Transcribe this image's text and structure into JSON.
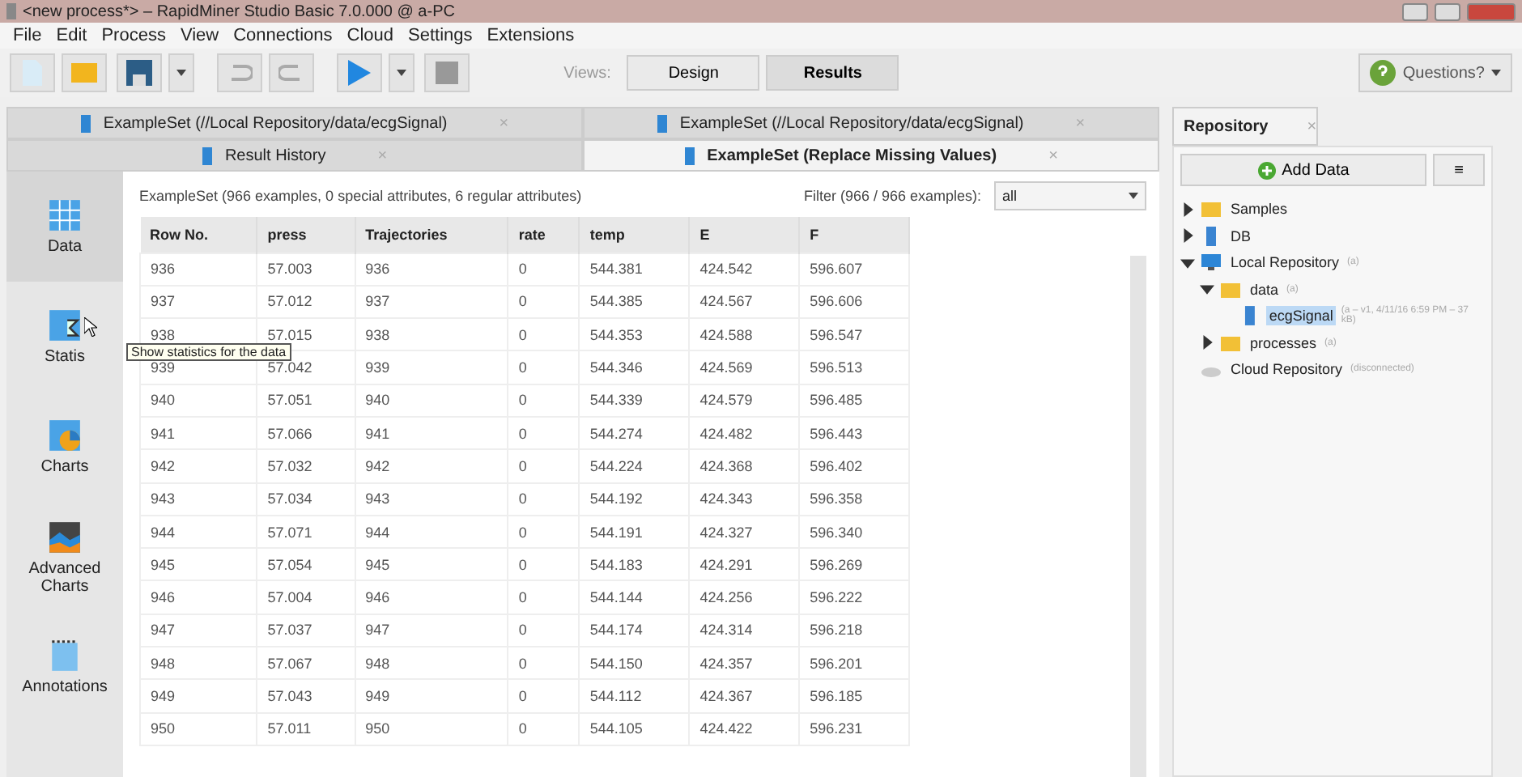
{
  "window": {
    "title": "<new process*> – RapidMiner Studio Basic 7.0.000 @ a-PC"
  },
  "menu": [
    "File",
    "Edit",
    "Process",
    "View",
    "Connections",
    "Cloud",
    "Settings",
    "Extensions"
  ],
  "views": {
    "label": "Views:",
    "items": [
      {
        "label": "Design",
        "selected": false
      },
      {
        "label": "Results",
        "selected": true
      }
    ]
  },
  "help": {
    "label": "Questions?"
  },
  "result_tab_rows": [
    [
      {
        "label": "ExampleSet (//Local Repository/data/ecgSignal)",
        "close": "×",
        "selected": false
      },
      {
        "label": "ExampleSet (//Local Repository/data/ecgSignal)",
        "close": "×",
        "selected": false
      }
    ],
    [
      {
        "label": "Result History",
        "close": "×",
        "selected": false
      },
      {
        "label": "ExampleSet (Replace Missing Values)",
        "close": "×",
        "selected": true
      }
    ]
  ],
  "side_nav": [
    {
      "label": "Data",
      "kind": "table",
      "selected": true
    },
    {
      "label": "Statis",
      "kind": "stats",
      "selected": false
    },
    {
      "label": "Charts",
      "kind": "charts",
      "selected": false
    },
    {
      "label": "Advanced Charts",
      "kind": "advanced",
      "selected": false
    },
    {
      "label": "Annotations",
      "kind": "notes",
      "selected": false
    }
  ],
  "tooltip": "Show statistics for the data",
  "summary": "ExampleSet (966 examples, 0 special attributes, 6 regular attributes)",
  "filter": {
    "label": "Filter (966 / 966 examples):",
    "value": "all"
  },
  "table": {
    "columns": [
      "Row No.",
      "press",
      "Trajectories",
      "rate",
      "temp",
      "E",
      "F"
    ],
    "rows": [
      [
        "936",
        "57.003",
        "936",
        "0",
        "544.381",
        "424.542",
        "596.607"
      ],
      [
        "937",
        "57.012",
        "937",
        "0",
        "544.385",
        "424.567",
        "596.606"
      ],
      [
        "938",
        "57.015",
        "938",
        "0",
        "544.353",
        "424.588",
        "596.547"
      ],
      [
        "939",
        "57.042",
        "939",
        "0",
        "544.346",
        "424.569",
        "596.513"
      ],
      [
        "940",
        "57.051",
        "940",
        "0",
        "544.339",
        "424.579",
        "596.485"
      ],
      [
        "941",
        "57.066",
        "941",
        "0",
        "544.274",
        "424.482",
        "596.443"
      ],
      [
        "942",
        "57.032",
        "942",
        "0",
        "544.224",
        "424.368",
        "596.402"
      ],
      [
        "943",
        "57.034",
        "943",
        "0",
        "544.192",
        "424.343",
        "596.358"
      ],
      [
        "944",
        "57.071",
        "944",
        "0",
        "544.191",
        "424.327",
        "596.340"
      ],
      [
        "945",
        "57.054",
        "945",
        "0",
        "544.183",
        "424.291",
        "596.269"
      ],
      [
        "946",
        "57.004",
        "946",
        "0",
        "544.144",
        "424.256",
        "596.222"
      ],
      [
        "947",
        "57.037",
        "947",
        "0",
        "544.174",
        "424.314",
        "596.218"
      ],
      [
        "948",
        "57.067",
        "948",
        "0",
        "544.150",
        "424.357",
        "596.201"
      ],
      [
        "949",
        "57.043",
        "949",
        "0",
        "544.112",
        "424.367",
        "596.185"
      ],
      [
        "950",
        "57.011",
        "950",
        "0",
        "544.105",
        "424.422",
        "596.231"
      ]
    ]
  },
  "repository": {
    "title": "Repository",
    "close": "×",
    "add_button": "Add Data",
    "menu_button": "≡",
    "tree": [
      {
        "label": "Samples",
        "kind": "folder",
        "expanded": false
      },
      {
        "label": "DB",
        "kind": "db",
        "expanded": false
      },
      {
        "label": "Local Repository",
        "meta": "(a)",
        "kind": "repo",
        "expanded": true,
        "children": [
          {
            "label": "data",
            "meta": "(a)",
            "kind": "folder",
            "expanded": true,
            "children": [
              {
                "label": "ecgSignal",
                "meta": "(a – v1, 4/11/16 6:59 PM – 37 kB)",
                "kind": "data",
                "selected": true
              }
            ]
          },
          {
            "label": "processes",
            "meta": "(a)",
            "kind": "folder",
            "expanded": false
          }
        ]
      },
      {
        "label": "Cloud Repository",
        "meta": "(disconnected)",
        "kind": "cloud"
      }
    ]
  }
}
